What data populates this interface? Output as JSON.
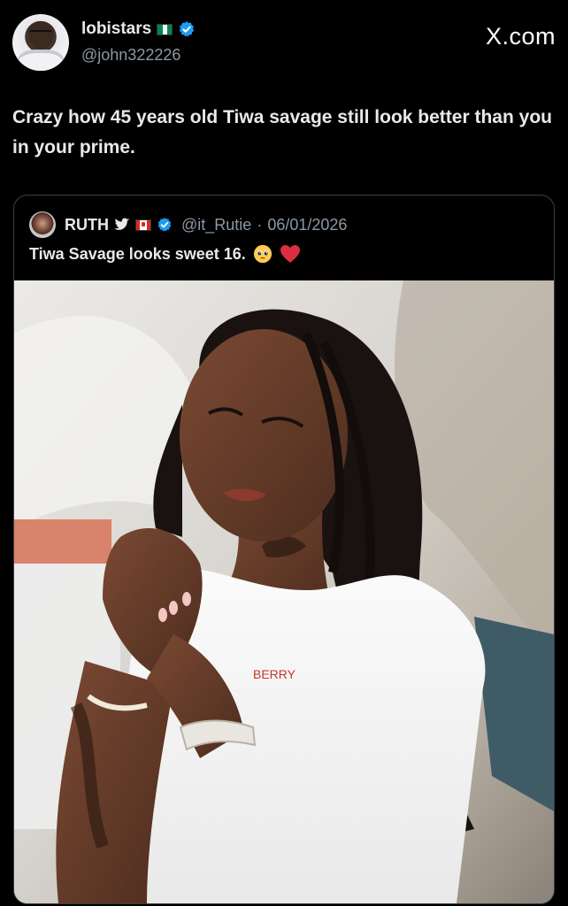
{
  "author": {
    "display_name": "lobistars",
    "handle": "@john322226",
    "flag_icon": "nigeria-flag-icon",
    "verified_icon": "verified-badge-icon"
  },
  "brand": {
    "label": "X.com"
  },
  "tweet": {
    "text": "Crazy how 45 years old Tiwa savage still look better than you in your prime."
  },
  "quoted_tweet": {
    "display_name": "RUTH",
    "handle": "@it_Rutie",
    "separator": "·",
    "date": "06/01/2026",
    "text": "Tiwa Savage looks sweet 16.",
    "emojis": [
      "pleading-face-emoji",
      "red-heart-emoji"
    ],
    "icons": [
      "bird-icon",
      "canada-flag-icon",
      "verified-badge-icon"
    ]
  },
  "colors": {
    "background": "#000000",
    "primary_text": "#e7e9ea",
    "secondary_text": "#8b98a5",
    "verified_blue": "#1d9bf0",
    "border": "#3a3f44"
  }
}
